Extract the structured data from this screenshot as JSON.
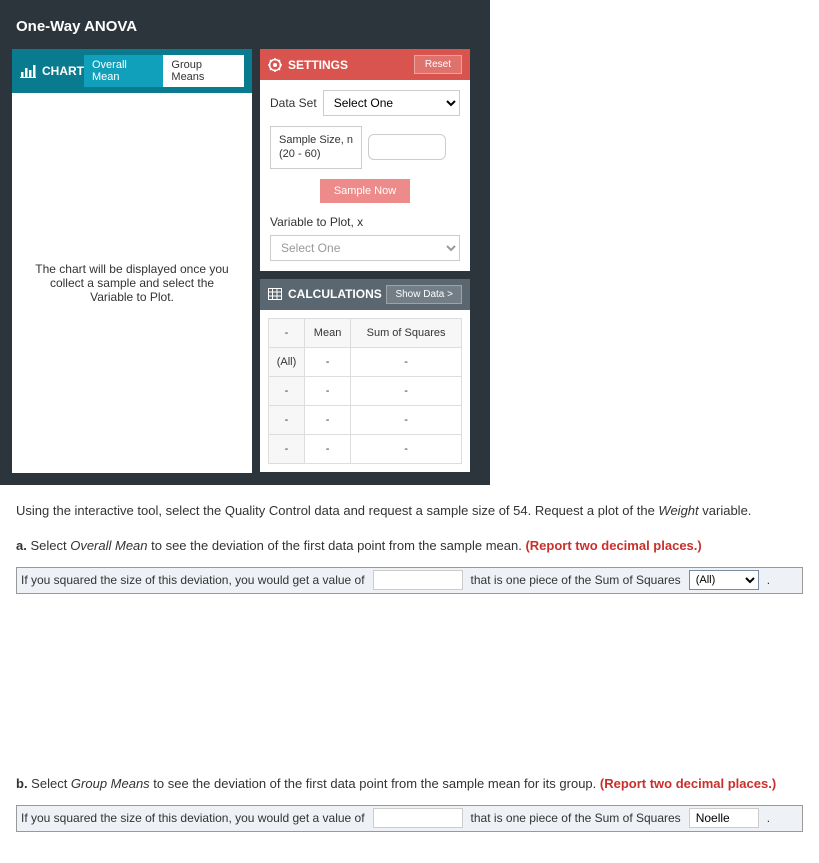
{
  "title": "One-Way ANOVA",
  "chart": {
    "header_label": "CHART",
    "tabs": {
      "overall": "Overall Mean",
      "group": "Group Means"
    },
    "placeholder": "The chart will be displayed once you collect a sample and select the Variable to Plot."
  },
  "settings": {
    "header_label": "SETTINGS",
    "reset": "Reset",
    "dataset_label": "Data Set",
    "dataset_placeholder": "Select One",
    "sample_size_label1": "Sample Size, n",
    "sample_size_label2": "(20 - 60)",
    "sample_now": "Sample Now",
    "var_label": "Variable to Plot, x",
    "var_placeholder": "Select One"
  },
  "calc": {
    "header_label": "CALCULATIONS",
    "show_data": "Show Data >",
    "cols": {
      "c0": "-",
      "c1": "Mean",
      "c2": "Sum of Squares"
    },
    "rows": [
      {
        "h": "(All)",
        "c1": "-",
        "c2": "-"
      },
      {
        "h": "-",
        "c1": "-",
        "c2": "-"
      },
      {
        "h": "-",
        "c1": "-",
        "c2": "-"
      },
      {
        "h": "-",
        "c1": "-",
        "c2": "-"
      }
    ]
  },
  "questions": {
    "intro_1": "Using the interactive tool, select the Quality Control data and request a sample size of 54. Request a plot of the ",
    "intro_italic": "Weight",
    "intro_2": " variable.",
    "a_prefix": "a.",
    "a_1": " Select ",
    "a_italic": "Overall Mean",
    "a_2": " to see the deviation of the first data point from the sample mean. ",
    "a_red": "(Report two decimal places.)",
    "b_prefix": "b.",
    "b_1": " Select ",
    "b_italic": "Group Means",
    "b_2": " to see the deviation of the first data point from the sample mean for its group. ",
    "b_red": "(Report two decimal places.)",
    "line_1": "If you squared the size of this deviation, you would get a value of",
    "line_2": "that is one piece of the Sum of Squares",
    "a_select_val": "(All)",
    "b_select_val": "Noelle"
  }
}
